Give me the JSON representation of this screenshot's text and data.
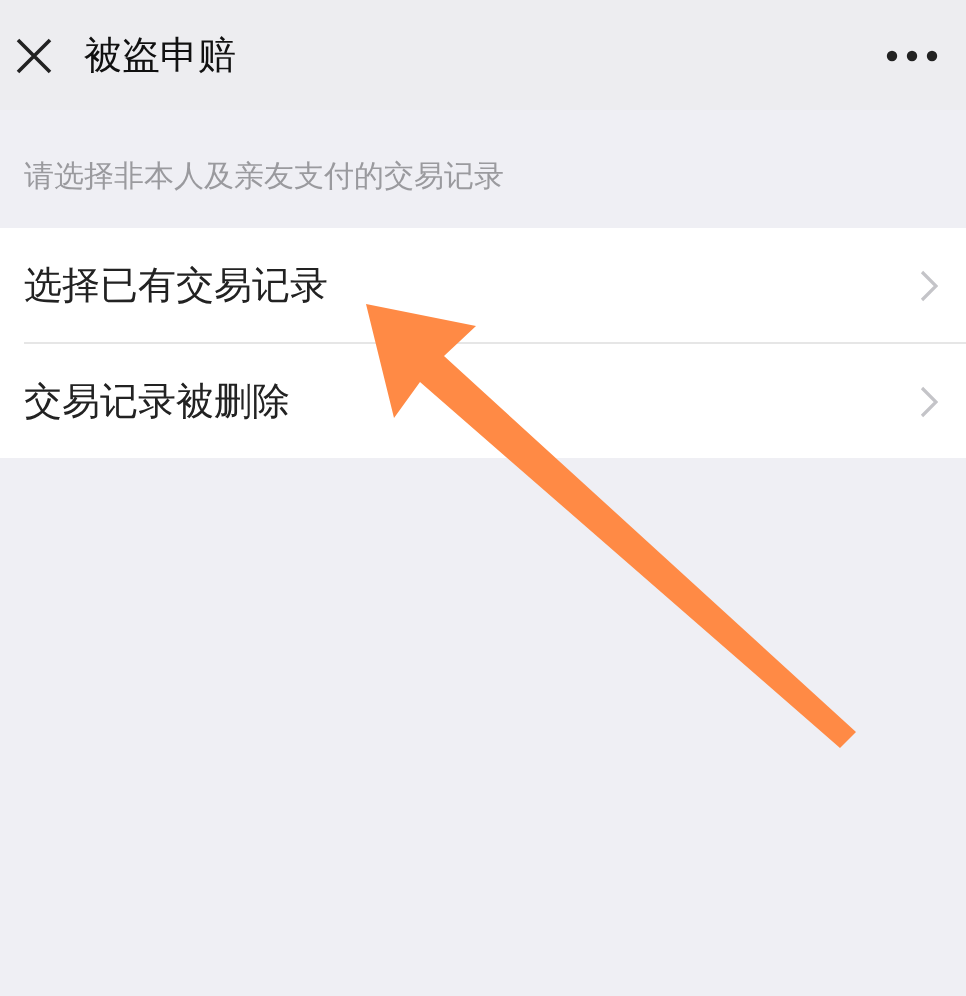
{
  "header": {
    "title": "被盗申赔"
  },
  "hint": "请选择非本人及亲友支付的交易记录",
  "options": [
    {
      "label": "选择已有交易记录"
    },
    {
      "label": "交易记录被删除"
    }
  ]
}
